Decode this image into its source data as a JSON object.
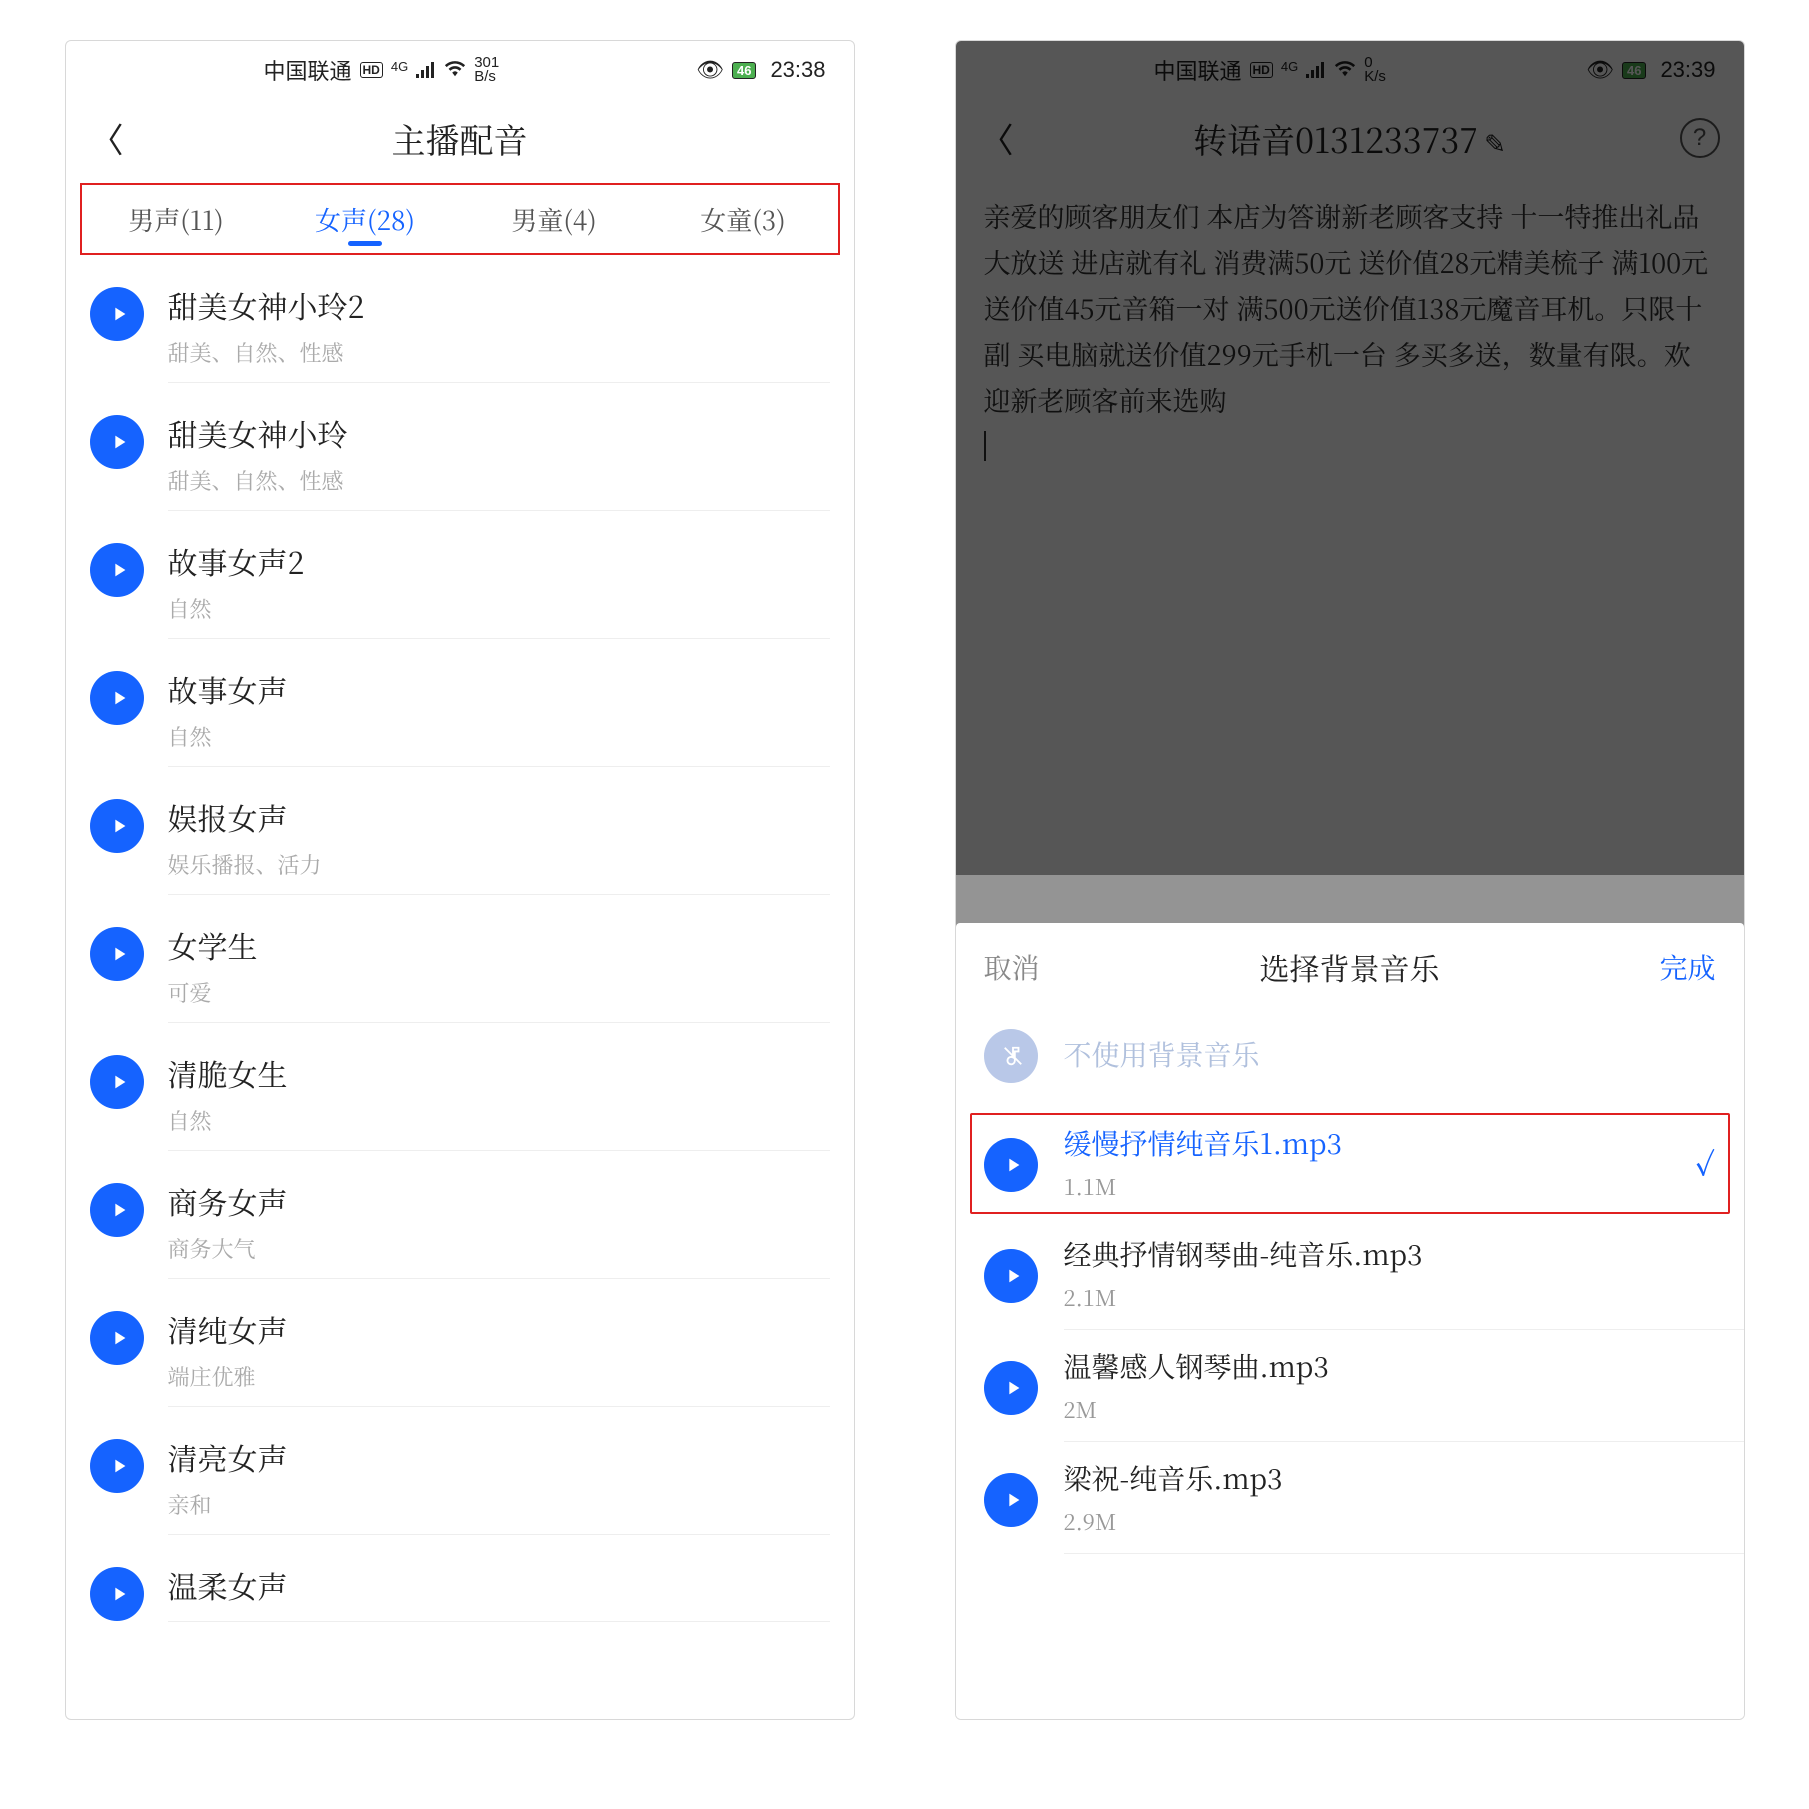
{
  "left": {
    "status": {
      "carrier": "中国联通",
      "hd": "HD",
      "net_top": "4G",
      "rate_top": "301",
      "rate_bottom": "B/s",
      "battery": "46",
      "time": "23:38"
    },
    "title": "主播配音",
    "tabs": [
      {
        "label": "男声(11)",
        "active": false
      },
      {
        "label": "女声(28)",
        "active": true
      },
      {
        "label": "男童(4)",
        "active": false
      },
      {
        "label": "女童(3)",
        "active": false
      }
    ],
    "voices": [
      {
        "name": "甜美女神小玲2",
        "tag": "甜美、自然、性感"
      },
      {
        "name": "甜美女神小玲",
        "tag": "甜美、自然、性感"
      },
      {
        "name": "故事女声2",
        "tag": "自然"
      },
      {
        "name": "故事女声",
        "tag": "自然"
      },
      {
        "name": "娱报女声",
        "tag": "娱乐播报、活力"
      },
      {
        "name": "女学生",
        "tag": "可爱"
      },
      {
        "name": "清脆女生",
        "tag": "自然"
      },
      {
        "name": "商务女声",
        "tag": "商务大气"
      },
      {
        "name": "清纯女声",
        "tag": "端庄优雅"
      },
      {
        "name": "清亮女声",
        "tag": "亲和"
      },
      {
        "name": "温柔女声",
        "tag": ""
      }
    ]
  },
  "right": {
    "status": {
      "carrier": "中国联通",
      "hd": "HD",
      "net_top": "4G",
      "rate_top": "0",
      "rate_bottom": "K/s",
      "battery": "46",
      "time": "23:39"
    },
    "title": "转语音0131233737",
    "body": "亲爱的顾客朋友们 本店为答谢新老顾客支持  十一特推出礼品大放送 进店就有礼  消费满50元 送价值28元精美梳子  满100元送价值45元音箱一对 满500元送价值138元魔音耳机。只限十副  买电脑就送价值299元手机一台  多买多送，数量有限。欢迎新老顾客前来选购",
    "sheet": {
      "cancel": "取消",
      "title": "选择背景音乐",
      "done": "完成",
      "nouse": "不使用背景音乐",
      "items": [
        {
          "name": "缓慢抒情纯音乐1.mp3",
          "size": "1.1M",
          "selected": true
        },
        {
          "name": "经典抒情钢琴曲-纯音乐.mp3",
          "size": "2.1M",
          "selected": false
        },
        {
          "name": "温馨感人钢琴曲.mp3",
          "size": "2M",
          "selected": false
        },
        {
          "name": "梁祝-纯音乐.mp3",
          "size": "2.9M",
          "selected": false
        }
      ]
    }
  }
}
